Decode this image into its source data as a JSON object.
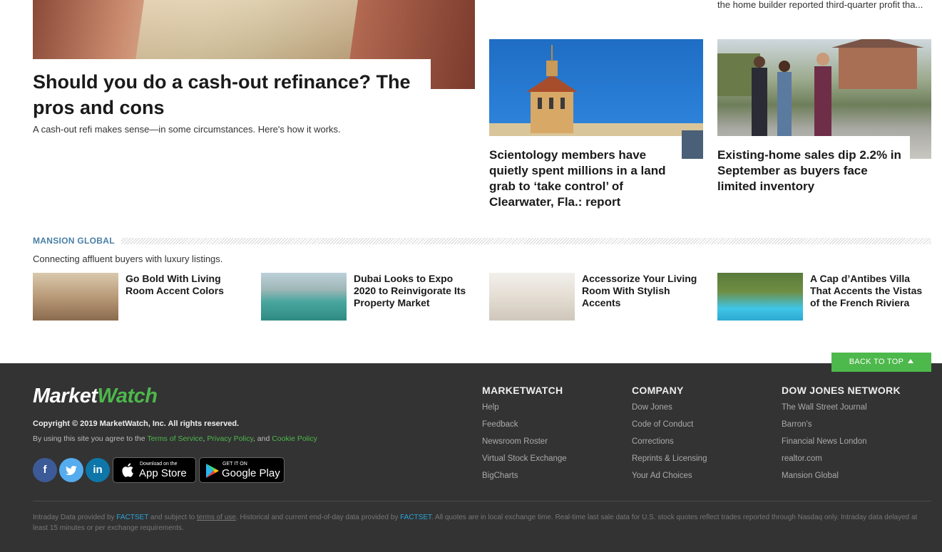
{
  "top_snippet": "the home builder reported third-quarter profit tha...",
  "lead_story": {
    "headline": "Should you do a cash-out refinance? The pros and cons",
    "dek": "A cash-out refi makes sense—in some circumstances. Here's how it works."
  },
  "story_scientology": {
    "headline": "Scientology members have quietly spent millions in a land grab to ‘take control’ of Clearwater, Fla.: report"
  },
  "story_home_sales": {
    "headline": "Existing-home sales dip 2.2% in September as buyers face limited inventory"
  },
  "mansion_global": {
    "label": "MANSION GLOBAL",
    "subtitle": "Connecting affluent buyers with luxury listings.",
    "items": [
      {
        "title": "Go Bold With Living Room Accent Colors"
      },
      {
        "title": "Dubai Looks to Expo 2020 to Reinvigorate Its Property Market"
      },
      {
        "title": "Accessorize Your Living Room With Stylish Accents"
      },
      {
        "title": "A Cap d’Antibes Villa That Accents the Vistas of the French Riviera"
      }
    ]
  },
  "footer": {
    "back_to_top": "BACK TO TOP",
    "logo_part1": "Market",
    "logo_part2": "Watch",
    "copyright": "Copyright © 2019 MarketWatch, Inc. All rights reserved.",
    "terms_prefix": "By using this site you agree to the ",
    "terms_of_service": "Terms of Service",
    "privacy_policy": "Privacy Policy",
    "terms_and": ", and ",
    "cookie_policy": "Cookie Policy",
    "social": {
      "facebook": "f",
      "twitter": "t",
      "linkedin": "in"
    },
    "appstore_small": "Download on the",
    "appstore_big": "App Store",
    "gplay_small": "GET IT ON",
    "gplay_big": "Google Play",
    "columns": [
      {
        "title": "MARKETWATCH",
        "links": [
          "Help",
          "Feedback",
          "Newsroom Roster",
          "Virtual Stock Exchange",
          "BigCharts"
        ]
      },
      {
        "title": "COMPANY",
        "links": [
          "Dow Jones",
          "Code of Conduct",
          "Corrections",
          "Reprints & Licensing",
          "Your Ad Choices"
        ]
      },
      {
        "title": "DOW JONES NETWORK",
        "links": [
          "The Wall Street Journal",
          "Barron's",
          "Financial News London",
          "realtor.com",
          "Mansion Global"
        ]
      }
    ],
    "disclaimer": {
      "p1": "Intraday Data provided by ",
      "factset1": "FACTSET",
      "p2": " and subject to ",
      "terms_of_use": "terms of use",
      "p3": ". Historical and current end-of-day data provided by ",
      "factset2": "FACTSET",
      "p4": ". All quotes are in local exchange time. Real-time last sale data for U.S. stock quotes reflect trades reported through Nasdaq only. Intraday data delayed at least 15 minutes or per exchange requirements."
    }
  },
  "colors": {
    "accent_green": "#4db84b",
    "footer_bg": "#333333",
    "mg_label": "#4a7fa6",
    "link_blue": "#2aa3d8"
  }
}
